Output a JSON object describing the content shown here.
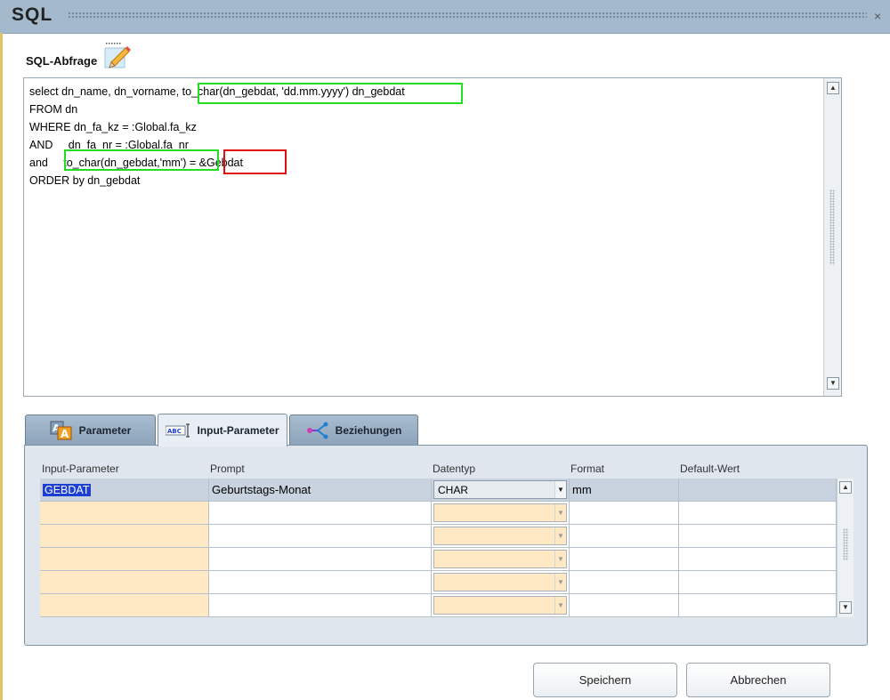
{
  "window": {
    "title": "SQL",
    "close_glyph": "×"
  },
  "section": {
    "heading": "SQL-Abfrage",
    "icon": "pencil-edit-icon"
  },
  "sql_lines": [
    "select dn_name, dn_vorname, to_char(dn_gebdat, 'dd.mm.yyyy') dn_gebdat",
    "FROM dn",
    "WHERE dn_fa_kz = :Global.fa_kz",
    "AND     dn_fa_nr = :Global.fa_nr",
    "and     to_char(dn_gebdat,'mm') = &Gebdat",
    "ORDER by dn_gebdat"
  ],
  "tabs": [
    {
      "label": "Parameter",
      "icon": "font-parameter-icon",
      "active": false
    },
    {
      "label": "Input-Parameter",
      "icon": "abc-text-cursor-icon",
      "active": true
    },
    {
      "label": "Beziehungen",
      "icon": "relations-icon",
      "active": false
    }
  ],
  "grid": {
    "columns": [
      "Input-Parameter",
      "Prompt",
      "Datentyp",
      "Format",
      "Default-Wert"
    ],
    "rows": [
      {
        "param": "GEBDAT",
        "prompt": "Geburtstags-Monat",
        "type": "CHAR",
        "format": "mm",
        "default": ""
      },
      {
        "param": "",
        "prompt": "",
        "type": "",
        "format": "",
        "default": ""
      },
      {
        "param": "",
        "prompt": "",
        "type": "",
        "format": "",
        "default": ""
      },
      {
        "param": "",
        "prompt": "",
        "type": "",
        "format": "",
        "default": ""
      },
      {
        "param": "",
        "prompt": "",
        "type": "",
        "format": "",
        "default": ""
      },
      {
        "param": "",
        "prompt": "",
        "type": "",
        "format": "",
        "default": ""
      }
    ]
  },
  "buttons": {
    "save": "Speichern",
    "cancel": "Abbrechen"
  },
  "colors": {
    "titlebar": "#a5b9cc",
    "highlight_green": "#22dd22",
    "highlight_red": "#e01010",
    "param_cell": "#ffe8c4",
    "selection": "#1c3fd4"
  }
}
